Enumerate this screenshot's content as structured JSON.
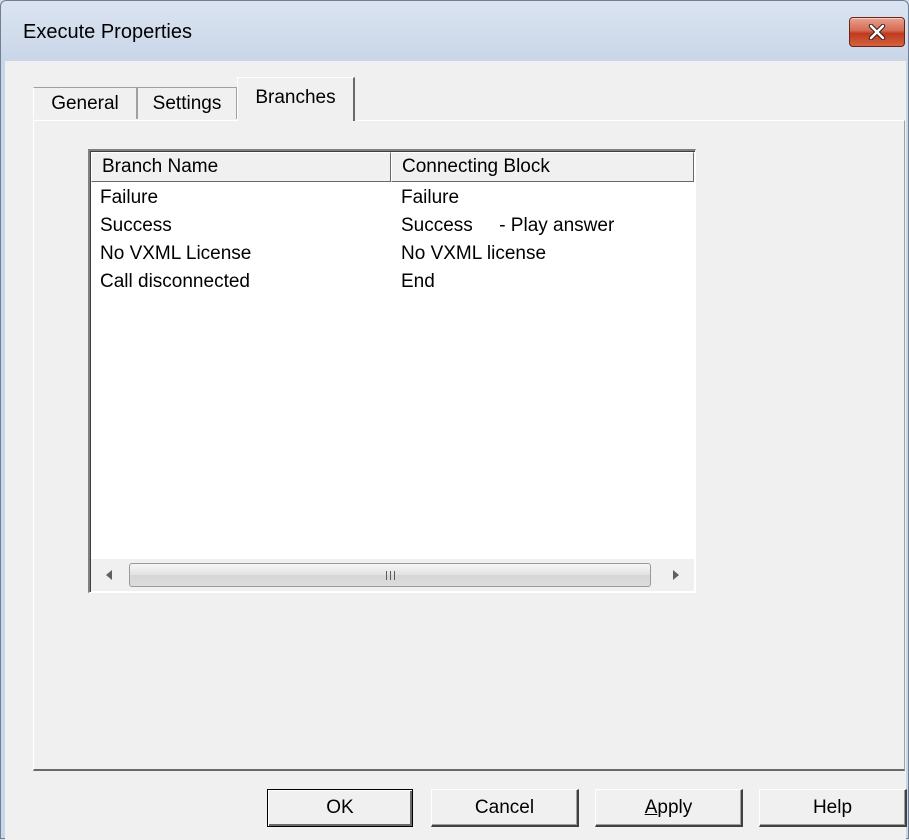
{
  "window": {
    "title": "Execute Properties",
    "close_icon": "close-icon"
  },
  "tabs": [
    {
      "label": "General",
      "active": false
    },
    {
      "label": "Settings",
      "active": false
    },
    {
      "label": "Branches",
      "active": true
    }
  ],
  "branches_list": {
    "columns": [
      "Branch Name",
      "Connecting Block"
    ],
    "rows": [
      {
        "branch": "Failure",
        "block": "Failure"
      },
      {
        "branch": "Success",
        "block": "Success     - Play answer"
      },
      {
        "branch": "No VXML License",
        "block": "No VXML license"
      },
      {
        "branch": "Call disconnected",
        "block": "End"
      }
    ],
    "scrollbar": {
      "left_icon": "scroll-left-arrow-icon",
      "right_icon": "scroll-right-arrow-icon"
    }
  },
  "buttons": {
    "ok": "OK",
    "cancel": "Cancel",
    "apply_accel": "A",
    "apply_rest": "pply",
    "help": "Help"
  }
}
